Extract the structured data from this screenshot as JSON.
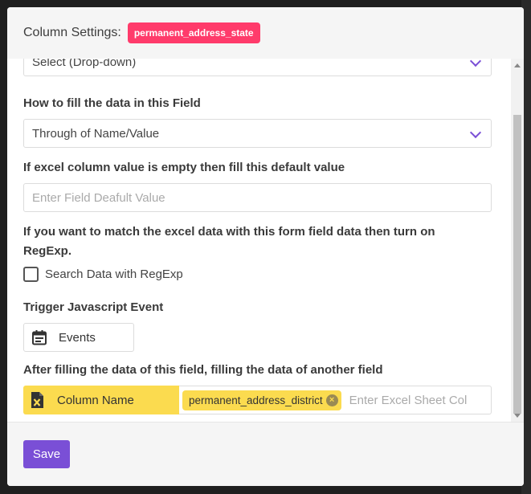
{
  "header": {
    "title": "Column Settings:",
    "badge": "permanent_address_state"
  },
  "fields": {
    "field_type": {
      "value": "Select (Drop-down)"
    },
    "fill_method": {
      "label": "How to fill the data in this Field",
      "value": "Through of Name/Value"
    },
    "default_value": {
      "label": "If excel column value is empty then fill this default value",
      "placeholder": "Enter Field Deafult Value"
    },
    "regexp": {
      "label_line1": "If you want to match the excel data with this form field data then turn on",
      "label_line2": "RegExp.",
      "checkbox_label": "Search Data with RegExp",
      "checked": false
    },
    "js_event": {
      "label": "Trigger Javascript Event",
      "button_label": "Events",
      "icon": "calendar-icon"
    },
    "another_field": {
      "label": "After filling the data of this field, filling the data of another field",
      "column_label": "Column Name",
      "icon": "excel-file-icon",
      "tag": "permanent_address_district",
      "placeholder": "Enter Excel Sheet Col"
    }
  },
  "footer": {
    "save_label": "Save"
  },
  "colors": {
    "accent": "#7a4fd6",
    "badge": "#ff3b6b",
    "highlight": "#fbdb4f"
  }
}
